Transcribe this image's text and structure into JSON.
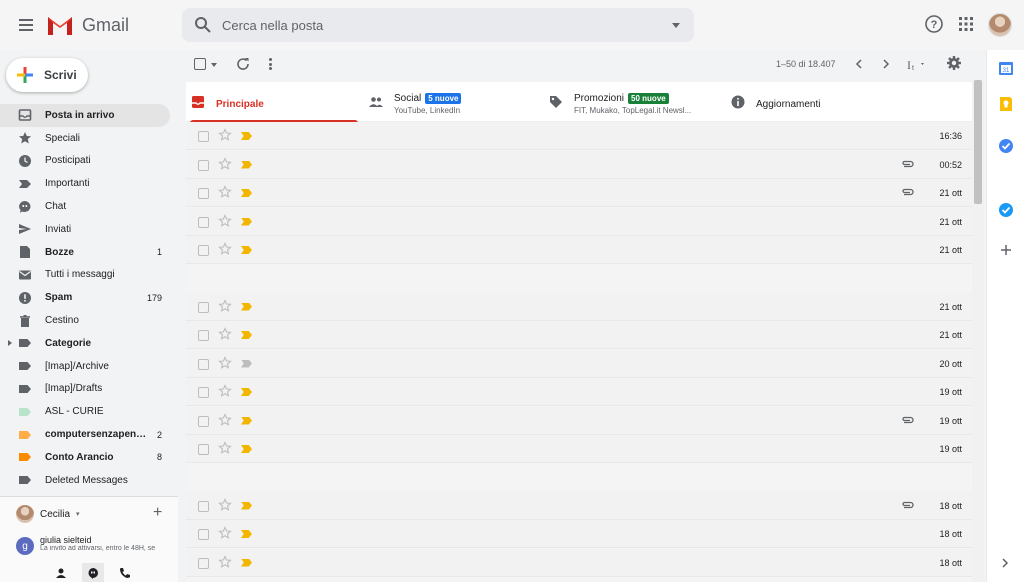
{
  "header": {
    "app_name": "Gmail",
    "search_placeholder": "Cerca nella posta"
  },
  "compose": {
    "label": "Scrivi"
  },
  "nav": [
    {
      "name": "inbox",
      "label": "Posta in arrivo",
      "count": "",
      "icon": "inbox-icon",
      "bold": true,
      "active": true
    },
    {
      "name": "starred",
      "label": "Speciali",
      "count": "",
      "icon": "star-icon"
    },
    {
      "name": "snoozed",
      "label": "Posticipati",
      "count": "",
      "icon": "clock-icon"
    },
    {
      "name": "important",
      "label": "Importanti",
      "count": "",
      "icon": "important-icon"
    },
    {
      "name": "chat",
      "label": "Chat",
      "count": "",
      "icon": "chat-icon"
    },
    {
      "name": "sent",
      "label": "Inviati",
      "count": "",
      "icon": "send-icon"
    },
    {
      "name": "drafts",
      "label": "Bozze",
      "count": "1",
      "icon": "draft-icon",
      "bold": true
    },
    {
      "name": "all-mail",
      "label": "Tutti i messaggi",
      "count": "",
      "icon": "mail-icon"
    },
    {
      "name": "spam",
      "label": "Spam",
      "count": "179",
      "icon": "spam-icon",
      "bold": true
    },
    {
      "name": "trash",
      "label": "Cestino",
      "count": "",
      "icon": "trash-icon"
    },
    {
      "name": "categories",
      "label": "Categorie",
      "count": "",
      "icon": "label-icon",
      "bold": true,
      "expander": true
    },
    {
      "name": "imap-archive",
      "label": "[Imap]/Archive",
      "count": "",
      "icon": "label-icon"
    },
    {
      "name": "imap-drafts",
      "label": "[Imap]/Drafts",
      "count": "",
      "icon": "label-icon"
    },
    {
      "name": "asl-curie",
      "label": "ASL - CURIE",
      "count": "",
      "icon": "label-icon",
      "color": "#b9e4c9"
    },
    {
      "name": "computersenzapensieri",
      "label": "computersenzapens...",
      "count": "2",
      "icon": "label-icon",
      "bold": true,
      "color": "#ffad46"
    },
    {
      "name": "conto-arancio",
      "label": "Conto Arancio",
      "count": "8",
      "icon": "label-icon",
      "bold": true,
      "color": "#fb8c00"
    },
    {
      "name": "deleted-messages",
      "label": "Deleted Messages",
      "count": "",
      "icon": "label-icon"
    }
  ],
  "hangouts": {
    "user": "Cecilia",
    "contact_initial": "g",
    "contact_name": "giulia sielteid",
    "contact_message": "La invito ad attivarsi, entro le 48H, se"
  },
  "toolbar": {
    "pager": "1–50 di 18.407"
  },
  "tabs": [
    {
      "name": "primary",
      "title": "Principale",
      "badge": "",
      "subtitle": "",
      "icon": "inbox-icon"
    },
    {
      "name": "social",
      "title": "Social",
      "badge": "5 nuove",
      "badge_color": "#1a73e8",
      "subtitle": "YouTube, LinkedIn",
      "icon": "people-icon"
    },
    {
      "name": "promotions",
      "title": "Promozioni",
      "badge": "50 nuove",
      "badge_color": "#188038",
      "subtitle": "FIT, Mukako, TopLegal.it Newsl...",
      "icon": "tag-icon"
    },
    {
      "name": "updates",
      "title": "Aggiornamenti",
      "badge": "",
      "subtitle": "",
      "icon": "info-icon"
    }
  ],
  "rows": [
    {
      "date": "16:36",
      "clip": false,
      "imp": "#f2b600"
    },
    {
      "date": "00:52",
      "clip": true,
      "imp": "#f2b600"
    },
    {
      "date": "21 ott",
      "clip": true,
      "imp": "#f2b600"
    },
    {
      "date": "21 ott",
      "clip": false,
      "imp": "#f2b600"
    },
    {
      "date": "21 ott",
      "clip": false,
      "imp": "#f2b600"
    },
    {
      "date": "21 ott",
      "clip": false,
      "imp": "#f2b600",
      "gap_before": true
    },
    {
      "date": "21 ott",
      "clip": false,
      "imp": "#f2b600"
    },
    {
      "date": "20 ott",
      "clip": false,
      "imp": "#bdbdbd"
    },
    {
      "date": "19 ott",
      "clip": false,
      "imp": "#f2b600"
    },
    {
      "date": "19 ott",
      "clip": true,
      "imp": "#f2b600"
    },
    {
      "date": "19 ott",
      "clip": false,
      "imp": "#f2b600"
    },
    {
      "date": "18 ott",
      "clip": true,
      "imp": "#f2b600",
      "gap_before": true
    },
    {
      "date": "18 ott",
      "clip": false,
      "imp": "#f2b600"
    },
    {
      "date": "18 ott",
      "clip": false,
      "imp": "#f2b600"
    }
  ],
  "colors": {
    "accent_red": "#d93025",
    "important_yellow": "#f2b600"
  }
}
